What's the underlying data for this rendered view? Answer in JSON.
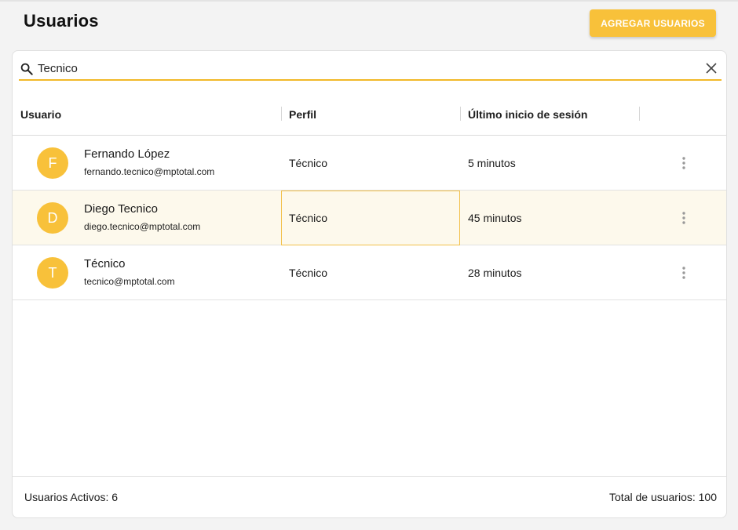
{
  "page": {
    "title": "Usuarios",
    "add_button_label": "AGREGAR USUARIOS"
  },
  "search": {
    "value": "Tecnico",
    "icon": "search-icon"
  },
  "table": {
    "columns": [
      "Usuario",
      "Perfil",
      "Último inicio de sesión"
    ],
    "rows": [
      {
        "initial": "F",
        "name": "Fernando López",
        "email": "fernando.tecnico@mptotal.com",
        "perfil": "Técnico",
        "last_login": "5 minutos"
      },
      {
        "initial": "D",
        "name": "Diego Tecnico",
        "email": "diego.tecnico@mptotal.com",
        "perfil": "Técnico",
        "last_login": "45 minutos"
      },
      {
        "initial": "T",
        "name": "Técnico",
        "email": "tecnico@mptotal.com",
        "perfil": "Técnico",
        "last_login": "28 minutos"
      }
    ]
  },
  "footer": {
    "active_users": "Usuarios Activos: 6",
    "total_users": "Total de usuarios: 100"
  },
  "colors": {
    "accent": "#f8c13a",
    "selected_row": "#fdf9ec"
  }
}
